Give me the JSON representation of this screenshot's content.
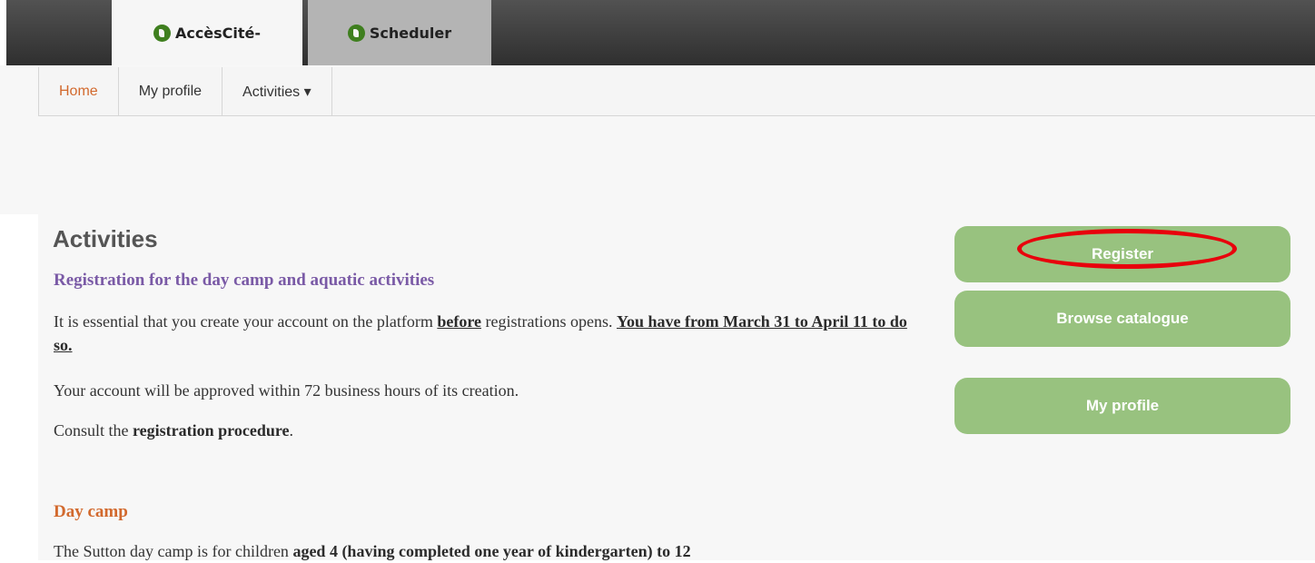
{
  "app_tabs": [
    {
      "label": "AccèsCité-",
      "icon": "accescite-logo-icon"
    },
    {
      "label": "Scheduler",
      "icon": "accescite-logo-icon"
    }
  ],
  "nav": {
    "items": [
      {
        "label": "Home"
      },
      {
        "label": "My profile"
      },
      {
        "label": "Activities ▾"
      }
    ]
  },
  "main": {
    "title": "Activities",
    "reg_heading": "Registration for the day camp and aquatic activities",
    "p1_before": "It is essential that you create your account on the platform ",
    "p1_em": "before",
    "p1_mid": " registrations opens. ",
    "p1_deadline": "You have from March 31 to April 11 to do so.",
    "p2": "Your account will be approved within 72 business hours of its creation.",
    "p3_before": "Consult the ",
    "p3_bold": "registration procedure",
    "p3_after": ".",
    "day_heading": "Day camp",
    "p4_before": "The Sutton day camp is for children ",
    "p4_bold": "aged 4 (having completed one year of kindergarten) to 12"
  },
  "sidebar": {
    "buttons": [
      {
        "label": "Register"
      },
      {
        "label": "Browse catalogue"
      },
      {
        "label": "My profile"
      }
    ]
  },
  "colors": {
    "accent_green": "#98c27f",
    "home_orange": "#d2692d",
    "heading_purple": "#7a5aa6",
    "annotation_red": "#e8000c"
  }
}
